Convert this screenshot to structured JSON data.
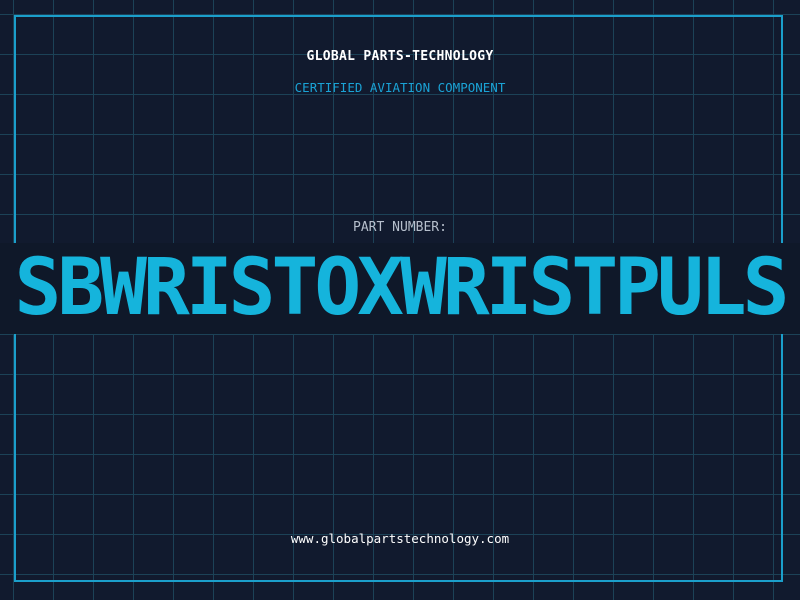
{
  "header": {
    "company": "GLOBAL PARTS-TECHNOLOGY",
    "tagline": "CERTIFIED AVIATION COMPONENT"
  },
  "part": {
    "label": "PART NUMBER:",
    "number": "SBWRISTOXWRISTPULS"
  },
  "footer": {
    "url": "www.globalpartstechnology.com"
  },
  "colors": {
    "background": "#111a2e",
    "grid": "#1c4257",
    "accent": "#1b9fcb",
    "part_number": "#15b4dc",
    "band": "#0f1829"
  }
}
